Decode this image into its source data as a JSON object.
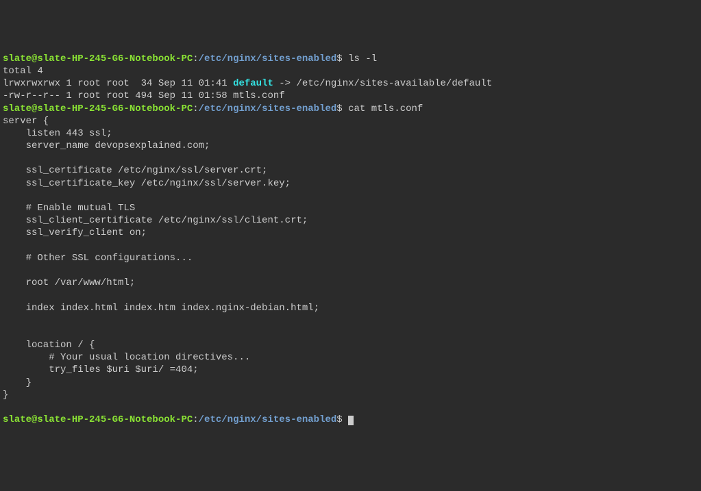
{
  "prompt": {
    "user": "slate@slate-HP-245-G6-Notebook-PC",
    "colon": ":",
    "path": "/etc/nginx/sites-enabled",
    "dollar": "$"
  },
  "cmd1": "ls -l",
  "ls": {
    "total": "total 4",
    "line1a": "lrwxrwxrwx 1 root root  34 Sep 11 01:41 ",
    "line1link": "default",
    "line1b": " -> /etc/nginx/sites-available/default",
    "line2": "-rw-r--r-- 1 root root 494 Sep 11 01:58 mtls.conf"
  },
  "cmd2": "cat mtls.conf",
  "cat": "server {\n    listen 443 ssl;\n    server_name devopsexplained.com;\n\n    ssl_certificate /etc/nginx/ssl/server.crt;\n    ssl_certificate_key /etc/nginx/ssl/server.key;\n\n    # Enable mutual TLS\n    ssl_client_certificate /etc/nginx/ssl/client.crt;\n    ssl_verify_client on;\n\n    # Other SSL configurations...\n\n    root /var/www/html;\n\n    index index.html index.htm index.nginx-debian.html;\n\n\n    location / {\n        # Your usual location directives...\n        try_files $uri $uri/ =404;\n    }\n}"
}
